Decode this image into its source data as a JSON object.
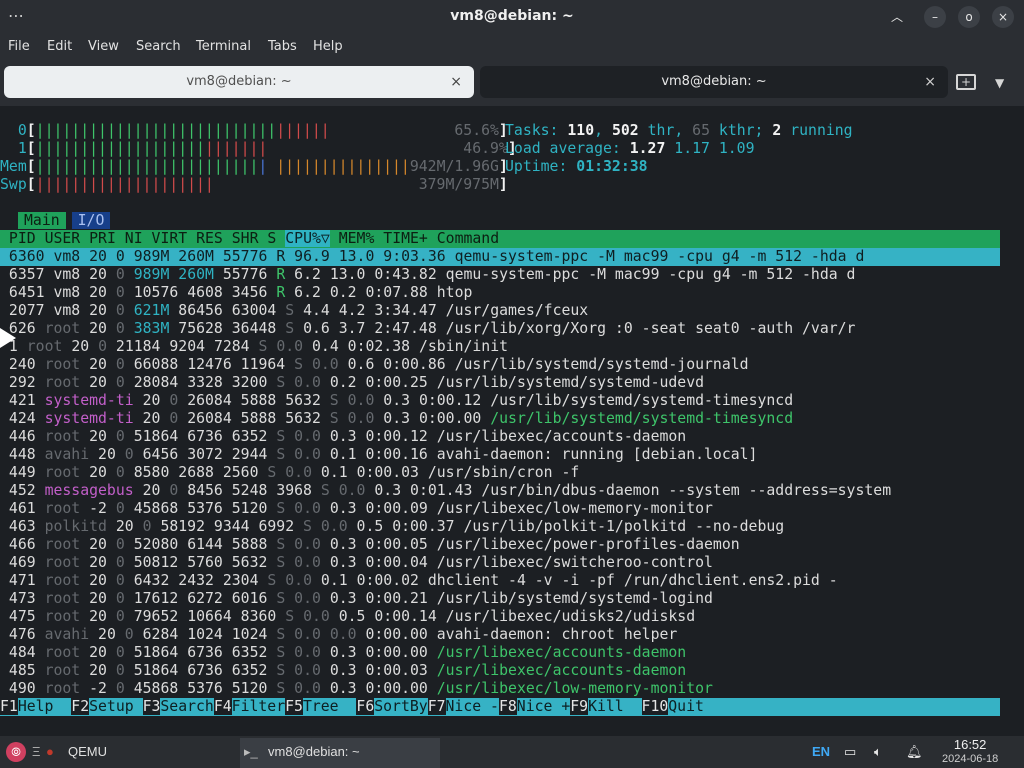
{
  "window": {
    "title": "vm8@debian: ~",
    "menu_dots": "⋯",
    "buttons": {
      "up": "︿",
      "minimize": "–",
      "maximize": "o",
      "close": "×"
    }
  },
  "menubar": [
    "File",
    "Edit",
    "View",
    "Search",
    "Terminal",
    "Tabs",
    "Help"
  ],
  "tabs": [
    {
      "label": "vm8@debian: ~",
      "active": false,
      "close": "×"
    },
    {
      "label": "vm8@debian: ~",
      "active": true,
      "close": "×"
    }
  ],
  "htop": {
    "cpu0": {
      "label": "0",
      "bar_green": "|||||||||||||||||||||||||||",
      "bar_red": "||||||",
      "pct": "65.6%"
    },
    "cpu1": {
      "label": "1",
      "bar_green": "|||||||||||||||||||",
      "bar_red": "|||||||",
      "pct": "46.9%"
    },
    "mem": {
      "label": "Mem",
      "bar_green": "|||||||||||||||||||||||||",
      "bar_blue": "|",
      "bar_orange": "|||||||||||||||",
      "value": "942M/1.96G"
    },
    "swp": {
      "label": "Swp",
      "bar_red": "||||||||||||||||||||",
      "value": "379M/975M"
    },
    "tasks": {
      "label": "Tasks:",
      "tasks": "110",
      "thr": "502",
      "thr_label": "thr,",
      "kthr": "65",
      "kthr_label": "kthr;",
      "running": "2",
      "running_label": "running"
    },
    "load": {
      "label": "Load average:",
      "v1": "1.27",
      "v2": "1.17",
      "v3": "1.09"
    },
    "uptime": {
      "label": "Uptime:",
      "value": "01:32:38"
    },
    "screen_tabs": [
      "Main",
      "I/O"
    ],
    "columns": [
      "PID",
      "USER",
      "PRI",
      "NI",
      "VIRT",
      "RES",
      "SHR",
      "S",
      "CPU%▽",
      "MEM%",
      "TIME+",
      "Command"
    ],
    "rows": [
      {
        "pid": "6360",
        "user": "vm8",
        "pri": "20",
        "ni": "0",
        "virt": "989M",
        "res": "260M",
        "shr": "55776",
        "s": "R",
        "cpu": "96.9",
        "mem": "13.0",
        "time": "9:03.36",
        "cmd": "qemu-system-ppc -M mac99 -cpu g4 -m 512 -hda d"
      },
      {
        "pid": "6357",
        "user": "vm8",
        "pri": "20",
        "ni": "0",
        "virt": "989M",
        "res": "260M",
        "shr": "55776",
        "s": "R",
        "cpu": "6.2",
        "mem": "13.0",
        "time": "0:43.82",
        "cmd": "qemu-system-ppc -M mac99 -cpu g4 -m 512 -hda d"
      },
      {
        "pid": "6451",
        "user": "vm8",
        "pri": "20",
        "ni": "0",
        "virt": "10576",
        "res": "4608",
        "shr": "3456",
        "s": "R",
        "cpu": "6.2",
        "mem": "0.2",
        "time": "0:07.88",
        "cmd": "htop"
      },
      {
        "pid": "2077",
        "user": "vm8",
        "pri": "20",
        "ni": "0",
        "virt": "621M",
        "res": "86456",
        "shr": "63004",
        "s": "S",
        "cpu": "4.4",
        "mem": "4.2",
        "time": "3:34.47",
        "cmd": "/usr/games/fceux"
      },
      {
        "pid": "626",
        "user": "root",
        "pri": "20",
        "ni": "0",
        "virt": "383M",
        "res": "75628",
        "shr": "36448",
        "s": "S",
        "cpu": "0.6",
        "mem": "3.7",
        "time": "2:47.48",
        "cmd": "/usr/lib/xorg/Xorg :0 -seat seat0 -auth /var/r"
      },
      {
        "pid": "1",
        "user": "root",
        "pri": "20",
        "ni": "0",
        "virt": "21184",
        "res": "9204",
        "shr": "7284",
        "s": "S",
        "cpu": "0.0",
        "mem": "0.4",
        "time": "0:02.38",
        "cmd": "/sbin/init"
      },
      {
        "pid": "240",
        "user": "root",
        "pri": "20",
        "ni": "0",
        "virt": "66088",
        "res": "12476",
        "shr": "11964",
        "s": "S",
        "cpu": "0.0",
        "mem": "0.6",
        "time": "0:00.86",
        "cmd": "/usr/lib/systemd/systemd-journald"
      },
      {
        "pid": "292",
        "user": "root",
        "pri": "20",
        "ni": "0",
        "virt": "28084",
        "res": "3328",
        "shr": "3200",
        "s": "S",
        "cpu": "0.0",
        "mem": "0.2",
        "time": "0:00.25",
        "cmd": "/usr/lib/systemd/systemd-udevd"
      },
      {
        "pid": "421",
        "user": "systemd-ti",
        "pri": "20",
        "ni": "0",
        "virt": "26084",
        "res": "5888",
        "shr": "5632",
        "s": "S",
        "cpu": "0.0",
        "mem": "0.3",
        "time": "0:00.12",
        "cmd": "/usr/lib/systemd/systemd-timesyncd"
      },
      {
        "pid": "424",
        "user": "systemd-ti",
        "pri": "20",
        "ni": "0",
        "virt": "26084",
        "res": "5888",
        "shr": "5632",
        "s": "S",
        "cpu": "0.0",
        "mem": "0.3",
        "time": "0:00.00",
        "cmd": "/usr/lib/systemd/systemd-timesyncd"
      },
      {
        "pid": "446",
        "user": "root",
        "pri": "20",
        "ni": "0",
        "virt": "51864",
        "res": "6736",
        "shr": "6352",
        "s": "S",
        "cpu": "0.0",
        "mem": "0.3",
        "time": "0:00.12",
        "cmd": "/usr/libexec/accounts-daemon"
      },
      {
        "pid": "448",
        "user": "avahi",
        "pri": "20",
        "ni": "0",
        "virt": "6456",
        "res": "3072",
        "shr": "2944",
        "s": "S",
        "cpu": "0.0",
        "mem": "0.1",
        "time": "0:00.16",
        "cmd": "avahi-daemon: running [debian.local]"
      },
      {
        "pid": "449",
        "user": "root",
        "pri": "20",
        "ni": "0",
        "virt": "8580",
        "res": "2688",
        "shr": "2560",
        "s": "S",
        "cpu": "0.0",
        "mem": "0.1",
        "time": "0:00.03",
        "cmd": "/usr/sbin/cron -f"
      },
      {
        "pid": "452",
        "user": "messagebus",
        "pri": "20",
        "ni": "0",
        "virt": "8456",
        "res": "5248",
        "shr": "3968",
        "s": "S",
        "cpu": "0.0",
        "mem": "0.3",
        "time": "0:01.43",
        "cmd": "/usr/bin/dbus-daemon --system --address=system"
      },
      {
        "pid": "461",
        "user": "root",
        "pri": "-2",
        "ni": "0",
        "virt": "45868",
        "res": "5376",
        "shr": "5120",
        "s": "S",
        "cpu": "0.0",
        "mem": "0.3",
        "time": "0:00.09",
        "cmd": "/usr/libexec/low-memory-monitor"
      },
      {
        "pid": "463",
        "user": "polkitd",
        "pri": "20",
        "ni": "0",
        "virt": "58192",
        "res": "9344",
        "shr": "6992",
        "s": "S",
        "cpu": "0.0",
        "mem": "0.5",
        "time": "0:00.37",
        "cmd": "/usr/lib/polkit-1/polkitd --no-debug"
      },
      {
        "pid": "466",
        "user": "root",
        "pri": "20",
        "ni": "0",
        "virt": "52080",
        "res": "6144",
        "shr": "5888",
        "s": "S",
        "cpu": "0.0",
        "mem": "0.3",
        "time": "0:00.05",
        "cmd": "/usr/libexec/power-profiles-daemon"
      },
      {
        "pid": "469",
        "user": "root",
        "pri": "20",
        "ni": "0",
        "virt": "50812",
        "res": "5760",
        "shr": "5632",
        "s": "S",
        "cpu": "0.0",
        "mem": "0.3",
        "time": "0:00.04",
        "cmd": "/usr/libexec/switcheroo-control"
      },
      {
        "pid": "471",
        "user": "root",
        "pri": "20",
        "ni": "0",
        "virt": "6432",
        "res": "2432",
        "shr": "2304",
        "s": "S",
        "cpu": "0.0",
        "mem": "0.1",
        "time": "0:00.02",
        "cmd": "dhclient -4 -v -i -pf /run/dhclient.ens2.pid -"
      },
      {
        "pid": "473",
        "user": "root",
        "pri": "20",
        "ni": "0",
        "virt": "17612",
        "res": "6272",
        "shr": "6016",
        "s": "S",
        "cpu": "0.0",
        "mem": "0.3",
        "time": "0:00.21",
        "cmd": "/usr/lib/systemd/systemd-logind"
      },
      {
        "pid": "475",
        "user": "root",
        "pri": "20",
        "ni": "0",
        "virt": "79652",
        "res": "10664",
        "shr": "8360",
        "s": "S",
        "cpu": "0.0",
        "mem": "0.5",
        "time": "0:00.14",
        "cmd": "/usr/libexec/udisks2/udisksd"
      },
      {
        "pid": "476",
        "user": "avahi",
        "pri": "20",
        "ni": "0",
        "virt": "6284",
        "res": "1024",
        "shr": "1024",
        "s": "S",
        "cpu": "0.0",
        "mem": "0.0",
        "time": "0:00.00",
        "cmd": "avahi-daemon: chroot helper"
      },
      {
        "pid": "484",
        "user": "root",
        "pri": "20",
        "ni": "0",
        "virt": "51864",
        "res": "6736",
        "shr": "6352",
        "s": "S",
        "cpu": "0.0",
        "mem": "0.3",
        "time": "0:00.00",
        "cmd": "/usr/libexec/accounts-daemon"
      },
      {
        "pid": "485",
        "user": "root",
        "pri": "20",
        "ni": "0",
        "virt": "51864",
        "res": "6736",
        "shr": "6352",
        "s": "S",
        "cpu": "0.0",
        "mem": "0.3",
        "time": "0:00.03",
        "cmd": "/usr/libexec/accounts-daemon"
      },
      {
        "pid": "490",
        "user": "root",
        "pri": "-2",
        "ni": "0",
        "virt": "45868",
        "res": "5376",
        "shr": "5120",
        "s": "S",
        "cpu": "0.0",
        "mem": "0.3",
        "time": "0:00.00",
        "cmd": "/usr/libexec/low-memory-monitor"
      }
    ],
    "footer": [
      {
        "key": "F1",
        "label": "Help  "
      },
      {
        "key": "F2",
        "label": "Setup "
      },
      {
        "key": "F3",
        "label": "Search"
      },
      {
        "key": "F4",
        "label": "Filter"
      },
      {
        "key": "F5",
        "label": "Tree  "
      },
      {
        "key": "F6",
        "label": "SortBy"
      },
      {
        "key": "F7",
        "label": "Nice -"
      },
      {
        "key": "F8",
        "label": "Nice +"
      },
      {
        "key": "F9",
        "label": "Kill  "
      },
      {
        "key": "F10",
        "label": "Quit"
      }
    ]
  },
  "taskbar": {
    "launcher_symbol": "⦾",
    "menu_glyph": "Ξ",
    "qemu_label": "QEMU",
    "terminal_label": "vm8@debian: ~",
    "lang": "EN",
    "time": "16:52",
    "date": "2024-06-18"
  },
  "colors": {
    "green_header": "#1fa25b",
    "cyan_selection": "#36b2c5",
    "terminal_bg": "#1c1f23"
  }
}
